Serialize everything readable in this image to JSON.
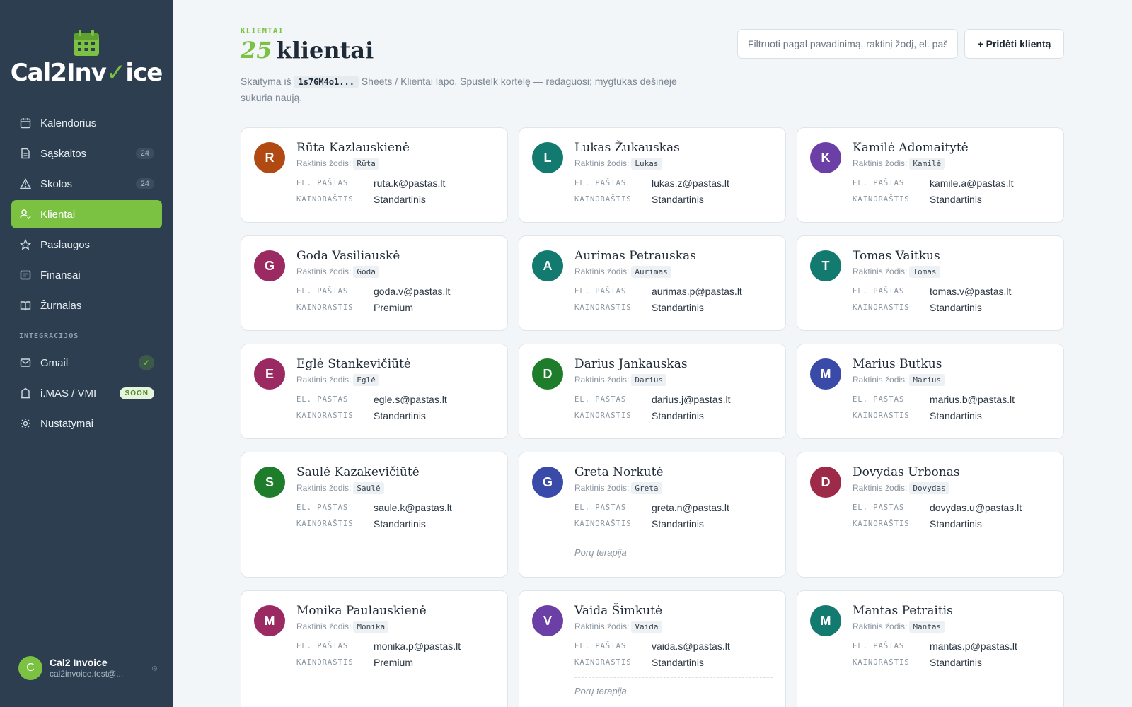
{
  "app": {
    "brand_main": "Cal2Inv",
    "brand_check": "✓",
    "brand_tail": "ice",
    "accent": "#7cc242",
    "sidebar_bg": "#2c3e50"
  },
  "sidebar": {
    "items": [
      {
        "label": "Kalendorius",
        "icon": "calendar-icon"
      },
      {
        "label": "Sąskaitos",
        "icon": "document-icon",
        "count": "24"
      },
      {
        "label": "Skolos",
        "icon": "warning-icon",
        "count": "24"
      },
      {
        "label": "Klientai",
        "icon": "user-check-icon",
        "active": true
      },
      {
        "label": "Paslaugos",
        "icon": "star-icon"
      },
      {
        "label": "Finansai",
        "icon": "receipt-icon"
      },
      {
        "label": "Žurnalas",
        "icon": "book-icon"
      }
    ],
    "section_label": "INTEGRACIJOS",
    "integrations": [
      {
        "label": "Gmail",
        "icon": "mail-icon",
        "status": "✓"
      },
      {
        "label": "i.MAS / VMI",
        "icon": "building-icon",
        "badge": "SOON"
      },
      {
        "label": "Nustatymai",
        "icon": "gear-icon"
      }
    ],
    "user": {
      "initial": "C",
      "name": "Cal2 Invoice",
      "email": "cal2invoice.test@...",
      "logout": "⦸"
    }
  },
  "header": {
    "eyebrow": "KLIENTAI",
    "count": "25",
    "title": "klientai",
    "subtitle_pre": "Skaityma iš",
    "subtitle_code": "1s7GM4o1...",
    "subtitle_post": "Sheets / Klientai lapo. Spustelk kortelę — redaguosi; mygtukas dešinėje sukuria naują.",
    "search_placeholder": "Filtruoti pagal pavadinimą, raktinį žodį, el. paštą",
    "add_button": "+ Pridėti klientą"
  },
  "labels": {
    "keyword": "Raktinis žodis:",
    "email": "EL. PAŠTAS",
    "pricelist": "KAINORAŠTIS"
  },
  "clients": [
    {
      "initial": "R",
      "name": "Rūta Kazlauskienė",
      "keyword": "Rūta",
      "email": "ruta.k@pastas.lt",
      "pricelist": "Standartinis",
      "color": "#b04a12"
    },
    {
      "initial": "L",
      "name": "Lukas Žukauskas",
      "keyword": "Lukas",
      "email": "lukas.z@pastas.lt",
      "pricelist": "Standartinis",
      "color": "#137a70"
    },
    {
      "initial": "K",
      "name": "Kamilė Adomaitytė",
      "keyword": "Kamilė",
      "email": "kamile.a@pastas.lt",
      "pricelist": "Standartinis",
      "color": "#6c3fa6"
    },
    {
      "initial": "G",
      "name": "Goda Vasiliauskė",
      "keyword": "Goda",
      "email": "goda.v@pastas.lt",
      "pricelist": "Premium",
      "color": "#9c2a62"
    },
    {
      "initial": "A",
      "name": "Aurimas Petrauskas",
      "keyword": "Aurimas",
      "email": "aurimas.p@pastas.lt",
      "pricelist": "Standartinis",
      "color": "#137a70"
    },
    {
      "initial": "T",
      "name": "Tomas Vaitkus",
      "keyword": "Tomas",
      "email": "tomas.v@pastas.lt",
      "pricelist": "Standartinis",
      "color": "#137a70"
    },
    {
      "initial": "E",
      "name": "Eglė Stankevičiūtė",
      "keyword": "Eglė",
      "email": "egle.s@pastas.lt",
      "pricelist": "Standartinis",
      "color": "#9c2a62"
    },
    {
      "initial": "D",
      "name": "Darius Jankauskas",
      "keyword": "Darius",
      "email": "darius.j@pastas.lt",
      "pricelist": "Standartinis",
      "color": "#1e7d2a"
    },
    {
      "initial": "M",
      "name": "Marius Butkus",
      "keyword": "Marius",
      "email": "marius.b@pastas.lt",
      "pricelist": "Standartinis",
      "color": "#3a4aa8"
    },
    {
      "initial": "S",
      "name": "Saulė Kazakevičiūtė",
      "keyword": "Saulė",
      "email": "saule.k@pastas.lt",
      "pricelist": "Standartinis",
      "color": "#1e7d2a"
    },
    {
      "initial": "G",
      "name": "Greta Norkutė",
      "keyword": "Greta",
      "email": "greta.n@pastas.lt",
      "pricelist": "Standartinis",
      "note": "Porų terapija",
      "color": "#3a4aa8"
    },
    {
      "initial": "D",
      "name": "Dovydas Urbonas",
      "keyword": "Dovydas",
      "email": "dovydas.u@pastas.lt",
      "pricelist": "Standartinis",
      "color": "#9c2a48"
    },
    {
      "initial": "M",
      "name": "Monika Paulauskienė",
      "keyword": "Monika",
      "email": "monika.p@pastas.lt",
      "pricelist": "Premium",
      "color": "#9c2a62"
    },
    {
      "initial": "V",
      "name": "Vaida Šimkutė",
      "keyword": "Vaida",
      "email": "vaida.s@pastas.lt",
      "pricelist": "Standartinis",
      "note": "Porų terapija",
      "color": "#6c3fa6"
    },
    {
      "initial": "M",
      "name": "Mantas Petraitis",
      "keyword": "Mantas",
      "email": "mantas.p@pastas.lt",
      "pricelist": "Standartinis",
      "color": "#137a70"
    }
  ]
}
